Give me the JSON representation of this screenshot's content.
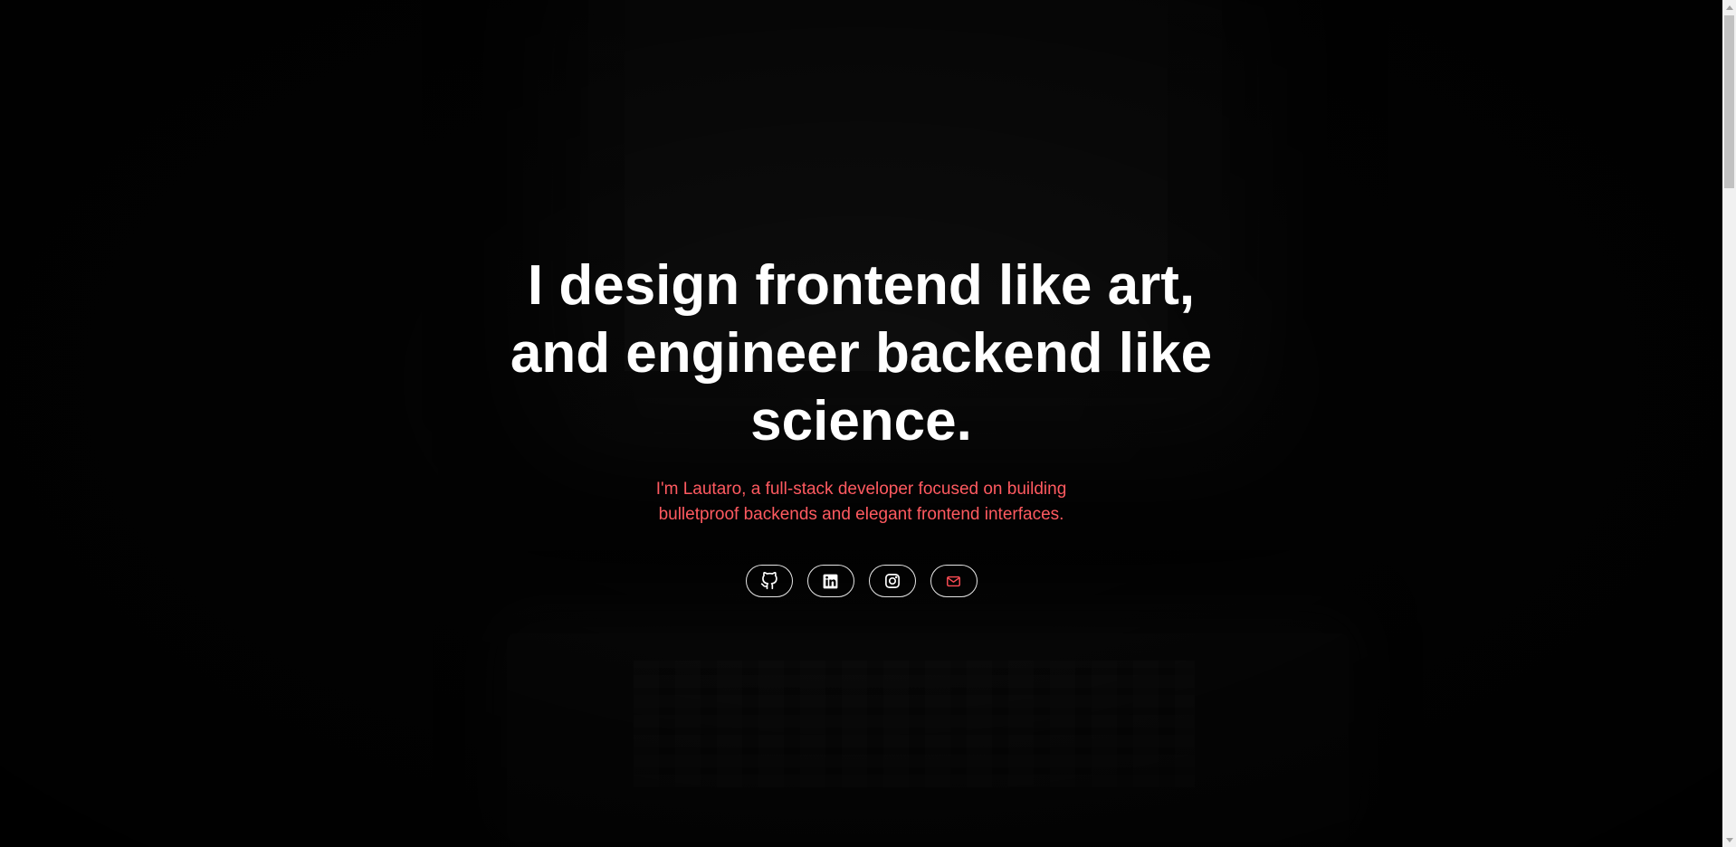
{
  "hero": {
    "headline": "I design frontend like art, and engineer backend like science.",
    "subtext": "I'm Lautaro, a full-stack developer focused on building bulletproof backends and elegant frontend interfaces."
  },
  "socials": [
    {
      "icon": "github-icon",
      "color": "#ffffff"
    },
    {
      "icon": "linkedin-icon",
      "color": "#ffffff"
    },
    {
      "icon": "instagram-icon",
      "color": "#ffffff"
    },
    {
      "icon": "mail-icon",
      "color": "#ff4d55"
    }
  ],
  "colors": {
    "background": "#000000",
    "headline": "#ffffff",
    "accent": "#ff5a60",
    "button_border": "#e6e6e6"
  }
}
